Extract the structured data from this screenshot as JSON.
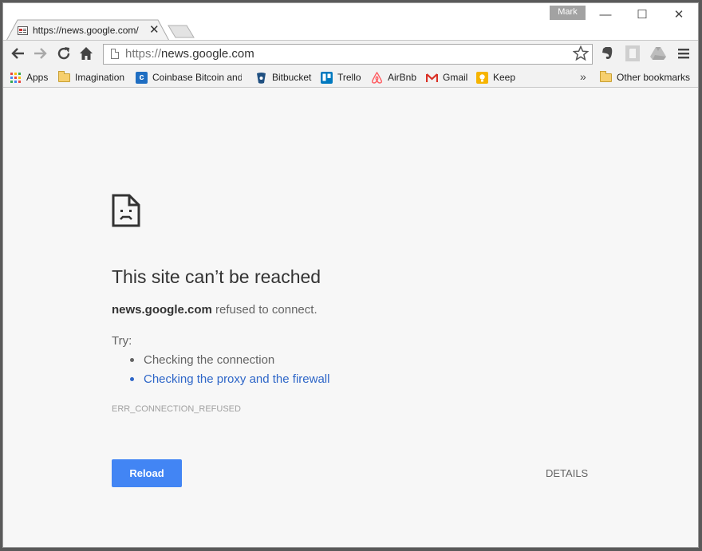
{
  "window": {
    "profile_name": "Mark",
    "controls": {
      "minimize": "—",
      "maximize": "☐",
      "close": "✕"
    }
  },
  "tab": {
    "title": "https://news.google.com/",
    "close": "✕"
  },
  "toolbar": {
    "url_scheme": "https://",
    "url_host": "news.google.com"
  },
  "bookmarks": {
    "items": [
      {
        "label": "Apps",
        "icon": "apps-grid-icon"
      },
      {
        "label": "Imagination",
        "icon": "folder-icon"
      },
      {
        "label": "Coinbase Bitcoin and",
        "icon": "coinbase-icon"
      },
      {
        "label": "Bitbucket",
        "icon": "bitbucket-icon"
      },
      {
        "label": "Trello",
        "icon": "trello-icon"
      },
      {
        "label": "AirBnb",
        "icon": "airbnb-icon"
      },
      {
        "label": "Gmail",
        "icon": "gmail-icon"
      },
      {
        "label": "Keep",
        "icon": "keep-icon"
      }
    ],
    "overflow": "»",
    "other": "Other bookmarks"
  },
  "error": {
    "title": "This site can’t be reached",
    "host": "news.google.com",
    "description": "refused to connect.",
    "try_label": "Try:",
    "suggestions": [
      "Checking the connection",
      "Checking the proxy and the firewall"
    ],
    "code": "ERR_CONNECTION_REFUSED",
    "reload_label": "Reload",
    "details_label": "DETAILS"
  },
  "colors": {
    "accent": "#4285f4",
    "link": "#2e66c8",
    "page_bg": "#f7f7f7",
    "chrome_bg": "#f2f2f2"
  }
}
